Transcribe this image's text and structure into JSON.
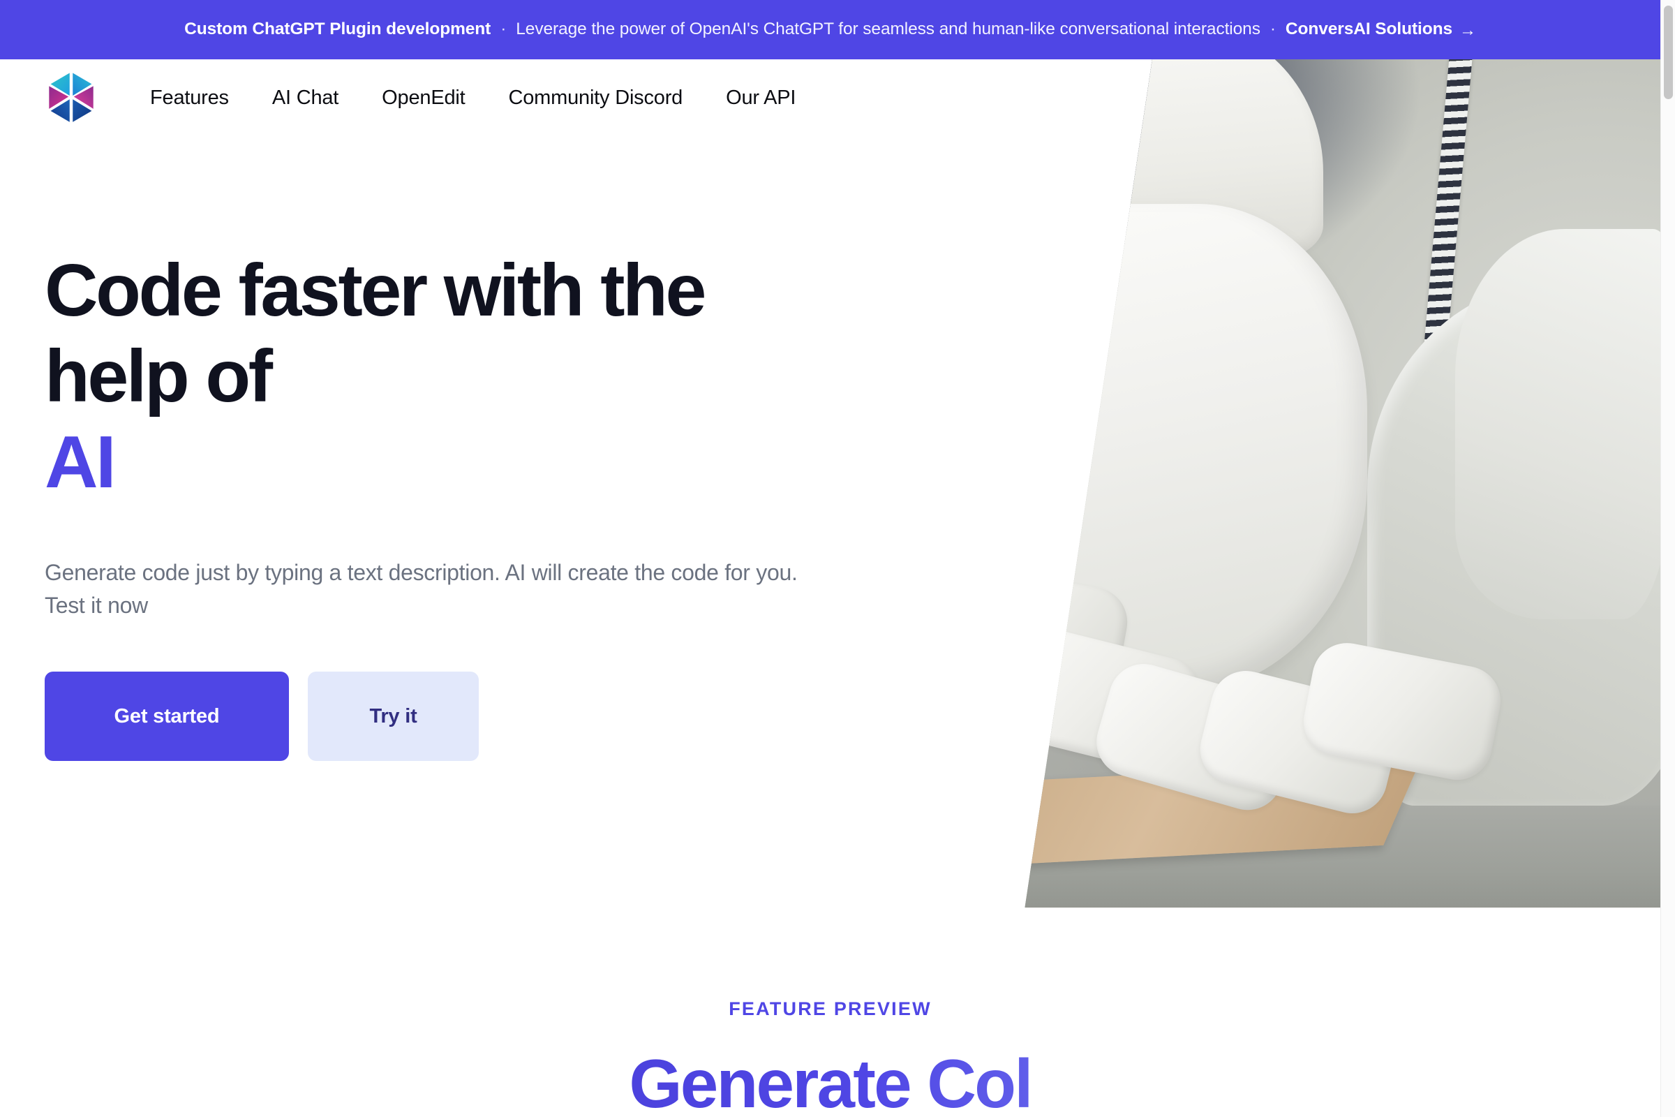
{
  "banner": {
    "strong": "Custom ChatGPT Plugin development",
    "separator_1": "·",
    "description": "Leverage the power of OpenAI's ChatGPT for seamless and human-like conversational interactions",
    "separator_2": "·",
    "cta_label": "ConversAI Solutions",
    "cta_arrow": "→",
    "background_color": "#4f46e5",
    "text_color": "#ffffff"
  },
  "header": {
    "logo_name": "hexagon-prism-logo",
    "nav": [
      {
        "label": "Features"
      },
      {
        "label": "AI Chat"
      },
      {
        "label": "OpenEdit"
      },
      {
        "label": "Community Discord"
      },
      {
        "label": "Our API"
      }
    ]
  },
  "hero": {
    "title_line_1": "Code faster with the",
    "title_line_2": "help of",
    "title_highlight": "AI",
    "highlight_color": "#4f46e5",
    "subtitle": "Generate code just by typing a text description. AI will create the code for you. Test it now",
    "primary_button": "Get started",
    "secondary_button": "Try it",
    "media_alt": "robotic-hand-photo"
  },
  "feature_section": {
    "eyebrow": "FEATURE PREVIEW",
    "title": "Generate Col",
    "gradient_from": "#4338ca",
    "gradient_to": "#8e96f7"
  },
  "scrollbar": {
    "name": "vertical-scrollbar",
    "thumb_color": "#c6c6c6"
  }
}
